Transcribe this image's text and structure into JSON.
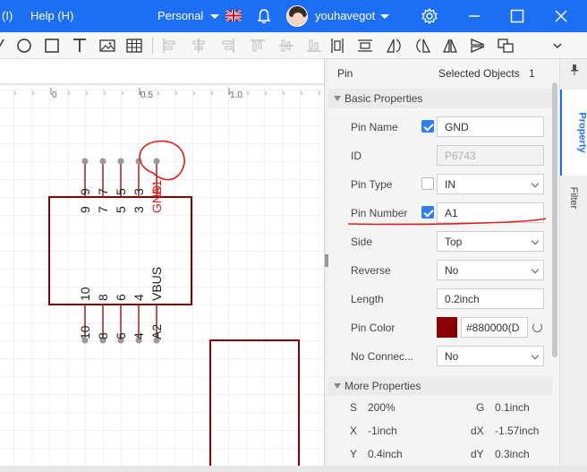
{
  "titlebar": {
    "menu_item_1": "(I)",
    "menu_item_2": "Help (H)",
    "workspace": "Personal",
    "username": "youhavegot"
  },
  "canvas": {
    "ruler_labels": [
      "0",
      "0.5",
      "1.0"
    ],
    "component": {
      "pins_top_outside": [
        "9",
        "7",
        "5",
        "3",
        "A1"
      ],
      "pins_top_inside": [
        "9",
        "7",
        "5",
        "3",
        "GND"
      ],
      "pins_bottom_inside": [
        "10",
        "8",
        "6",
        "4",
        "VBUS"
      ],
      "pins_bottom_outside": [
        "10",
        "8",
        "6",
        "4",
        "A2"
      ]
    },
    "colors": {
      "body": "#880000",
      "pin_dot": "#9a9a9a",
      "annotation": "#e0201c",
      "selected_label": "#e0201c"
    }
  },
  "panel": {
    "title": "Pin",
    "selected_label": "Selected Objects",
    "selected_count": "1",
    "basic_section": "Basic Properties",
    "rows": {
      "pin_name": {
        "label": "Pin Name",
        "checked": true,
        "value": "GND"
      },
      "id": {
        "label": "ID",
        "value": "P6743"
      },
      "pin_type": {
        "label": "Pin Type",
        "checked": false,
        "value": "IN"
      },
      "pin_number": {
        "label": "Pin Number",
        "checked": true,
        "value": "A1"
      },
      "side": {
        "label": "Side",
        "value": "Top"
      },
      "reverse": {
        "label": "Reverse",
        "value": "No"
      },
      "length": {
        "label": "Length",
        "value": "0.2inch"
      },
      "pin_color": {
        "label": "Pin Color",
        "value": "#880000(D",
        "swatch": "#880000"
      },
      "no_connect": {
        "label": "No Connec...",
        "value": "No"
      }
    },
    "more_section": "More Properties",
    "more": {
      "s_key": "S",
      "s_val": "200%",
      "g_key": "G",
      "g_val": "0.1inch",
      "x_key": "X",
      "x_val": "-1inch",
      "dx_key": "dX",
      "dx_val": "-1.57inch",
      "y_key": "Y",
      "y_val": "0.4inch",
      "dy_key": "dY",
      "dy_val": "0.3inch"
    }
  },
  "side_tabs": {
    "property": "Property",
    "filter": "Filter"
  },
  "colors": {
    "accent": "#1c6ef2",
    "checkbox": "#2f7cf6"
  }
}
